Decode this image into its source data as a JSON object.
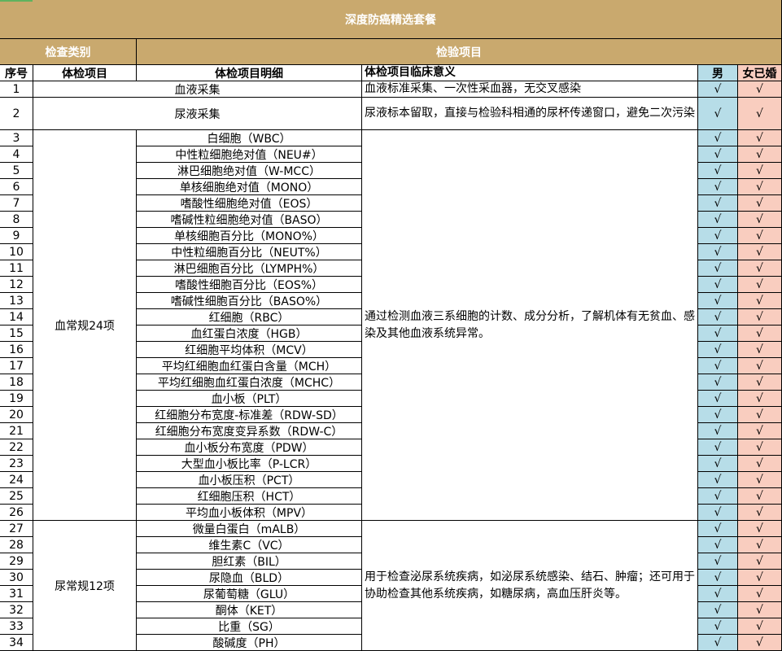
{
  "title": "深度防癌精选套餐",
  "header_groups": {
    "category": "检查类别",
    "items": "检验项目"
  },
  "columns": {
    "no": "序号",
    "item": "体检项目",
    "detail": "体检项目明细",
    "meaning": "体检项目临床意义",
    "male": "男",
    "female_married": "女已婚"
  },
  "standalone_rows": [
    {
      "no": "1",
      "label": "血液采集",
      "meaning": "血液标准采集、一次性采血器，无交叉感染",
      "male": "√",
      "female": "√"
    },
    {
      "no": "2",
      "label": "尿液采集",
      "meaning": "尿液标本留取，直接与检验科相通的尿杯传递窗口，避免二次污染",
      "male": "√",
      "female": "√"
    }
  ],
  "groups": [
    {
      "name": "血常规24项",
      "meaning": "通过检测血液三系细胞的计数、成分分析，了解机体有无贫血、感染及其他血液系统异常。",
      "rows": [
        {
          "no": "3",
          "detail": "白细胞（WBC）",
          "male": "√",
          "female": "√"
        },
        {
          "no": "4",
          "detail": "中性粒细胞绝对值（NEU#）",
          "male": "√",
          "female": "√"
        },
        {
          "no": "5",
          "detail": "淋巴细胞绝对值（W-MCC）",
          "male": "√",
          "female": "√"
        },
        {
          "no": "6",
          "detail": "单核细胞绝对值（MONO）",
          "male": "√",
          "female": "√"
        },
        {
          "no": "7",
          "detail": "嗜酸性细胞绝对值（EOS）",
          "male": "√",
          "female": "√"
        },
        {
          "no": "8",
          "detail": "嗜碱性粒细胞绝对值（BASO）",
          "male": "√",
          "female": "√"
        },
        {
          "no": "9",
          "detail": "单核细胞百分比（MONO%）",
          "male": "√",
          "female": "√"
        },
        {
          "no": "10",
          "detail": "中性粒细胞百分比（NEUT%）",
          "male": "√",
          "female": "√"
        },
        {
          "no": "11",
          "detail": "淋巴细胞百分比（LYMPH%）",
          "male": "√",
          "female": "√"
        },
        {
          "no": "12",
          "detail": "嗜酸性细胞百分比（EOS%）",
          "male": "√",
          "female": "√"
        },
        {
          "no": "13",
          "detail": "嗜碱性细胞百分比（BASO%）",
          "male": "√",
          "female": "√"
        },
        {
          "no": "14",
          "detail": "红细胞（RBC）",
          "male": "√",
          "female": "√"
        },
        {
          "no": "15",
          "detail": "血红蛋白浓度（HGB）",
          "male": "√",
          "female": "√"
        },
        {
          "no": "16",
          "detail": "红细胞平均体积（MCV）",
          "male": "√",
          "female": "√"
        },
        {
          "no": "17",
          "detail": "平均红细胞血红蛋白含量（MCH）",
          "male": "√",
          "female": "√"
        },
        {
          "no": "18",
          "detail": "平均红细胞血红蛋白浓度（MCHC）",
          "male": "√",
          "female": "√"
        },
        {
          "no": "19",
          "detail": "血小板（PLT）",
          "male": "√",
          "female": "√"
        },
        {
          "no": "20",
          "detail": "红细胞分布宽度-标准差（RDW-SD）",
          "male": "√",
          "female": "√"
        },
        {
          "no": "21",
          "detail": "红细胞分布宽度变异系数（RDW-C）",
          "male": "√",
          "female": "√"
        },
        {
          "no": "22",
          "detail": "血小板分布宽度（PDW）",
          "male": "√",
          "female": "√"
        },
        {
          "no": "23",
          "detail": "大型血小板比率（P-LCR）",
          "male": "√",
          "female": "√"
        },
        {
          "no": "24",
          "detail": "血小板压积（PCT）",
          "male": "√",
          "female": "√"
        },
        {
          "no": "25",
          "detail": "红细胞压积（HCT）",
          "male": "√",
          "female": "√"
        },
        {
          "no": "26",
          "detail": "平均血小板体积（MPV）",
          "male": "√",
          "female": "√"
        }
      ]
    },
    {
      "name": "尿常规12项",
      "meaning": "用于检查泌尿系统疾病，如泌尿系统感染、结石、肿瘤；还可用于协助检查其他系统疾病，如糖尿病，高血压肝炎等。",
      "rows": [
        {
          "no": "27",
          "detail": "微量白蛋白（mALB）",
          "male": "√",
          "female": "√"
        },
        {
          "no": "28",
          "detail": "维生素C（VC）",
          "male": "√",
          "female": "√"
        },
        {
          "no": "29",
          "detail": "胆红素（BIL）",
          "male": "√",
          "female": "√"
        },
        {
          "no": "30",
          "detail": "尿隐血（BLD）",
          "male": "√",
          "female": "√"
        },
        {
          "no": "31",
          "detail": "尿葡萄糖（GLU）",
          "male": "√",
          "female": "√"
        },
        {
          "no": "32",
          "detail": "酮体（KET）",
          "male": "√",
          "female": "√"
        },
        {
          "no": "33",
          "detail": "比重（SG）",
          "male": "√",
          "female": "√"
        },
        {
          "no": "34",
          "detail": "酸碱度（PH）",
          "male": "√",
          "female": "√"
        }
      ]
    }
  ]
}
